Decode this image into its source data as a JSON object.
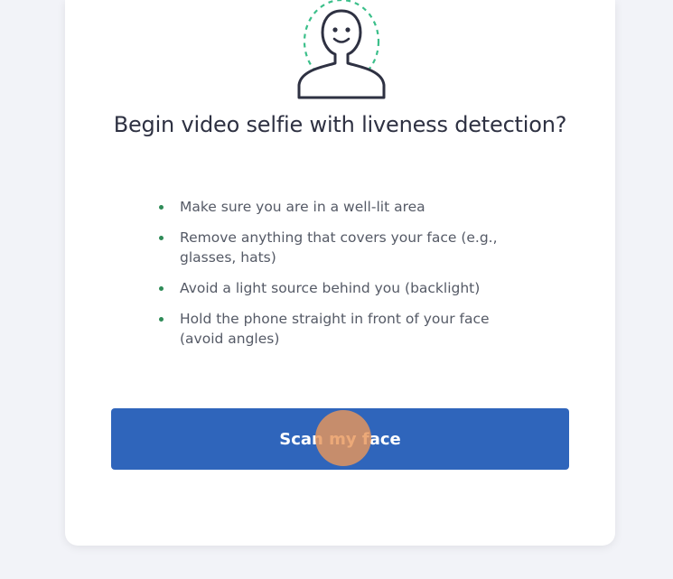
{
  "dialog": {
    "title": "Begin video selfie with liveness detection?",
    "illustration_icon": "face-scan-icon",
    "tips": [
      "Make sure you are in a well-lit area",
      "Remove anything that covers your face (e.g., glasses, hats)",
      "Avoid a light source behind you (backlight)",
      "Hold the phone straight in front of your face (avoid angles)"
    ],
    "primary_button_label": "Scan my face"
  },
  "colors": {
    "button": "#2f65bb",
    "bullet": "#2e8b57",
    "face_outline": "#2e3142",
    "face_dashed_ring": "#3bbf8a",
    "click_indicator": "#e8965a"
  }
}
